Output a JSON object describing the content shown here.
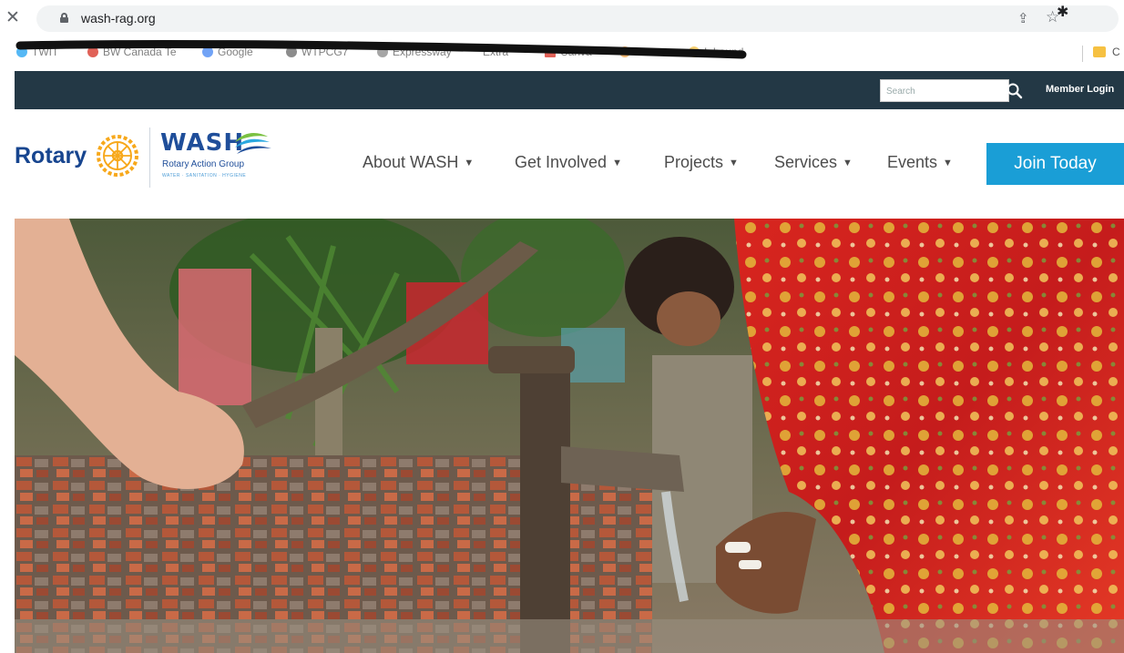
{
  "browser": {
    "url": "wash-rag.org",
    "bookmarks": [
      "TWIT",
      "BW Canada Te",
      "Google",
      "WTPCG7",
      "Expressway",
      "Extra",
      "Canva",
      "Bills",
      "Inbound"
    ]
  },
  "topbar": {
    "search_placeholder": "Search",
    "member_login": "Member Login"
  },
  "header": {
    "rotary": "Rotary",
    "wash": "WASH",
    "wash_subtitle": "Rotary Action Group",
    "wash_tagline": "WATER · SANITATION · HYGIENE"
  },
  "nav": {
    "items": [
      "About WASH",
      "Get Involved",
      "Projects",
      "Services",
      "Events"
    ],
    "join": "Join Today"
  },
  "colors": {
    "topbar": "#233845",
    "join_button": "#1a9ed6",
    "rotary_blue": "#17458f",
    "rotary_gold": "#f7a81b"
  },
  "icons": [
    "close-icon",
    "lock-icon",
    "share-icon",
    "star-icon",
    "extensions-icon",
    "search-icon",
    "rotary-wheel-logo",
    "wash-waves-logo",
    "chevron-down-icon"
  ]
}
